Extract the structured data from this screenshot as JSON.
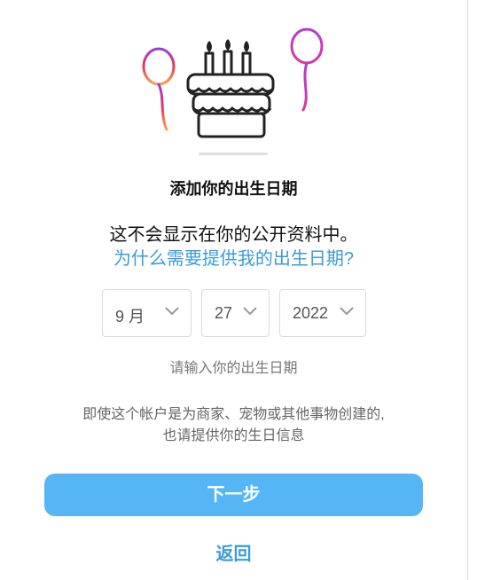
{
  "title": "添加你的出生日期",
  "description": "这不会显示在你的公开资料中。",
  "why_link": "为什么需要提供我的出生日期?",
  "birthday": {
    "month": "9 月",
    "day": "27",
    "year": "2022"
  },
  "hint": "请输入你的出生日期",
  "note_line1": "即使这个帐户是为商家、宠物或其他事物创建的,",
  "note_line2": "也请提供你的生日信息",
  "next_button": "下一步",
  "back_link": "返回",
  "colors": {
    "accent": "#3b9cd9",
    "button": "#56b5f5"
  },
  "icons": [
    "birthday-cake-icon",
    "balloon-icon",
    "chevron-down-icon"
  ]
}
